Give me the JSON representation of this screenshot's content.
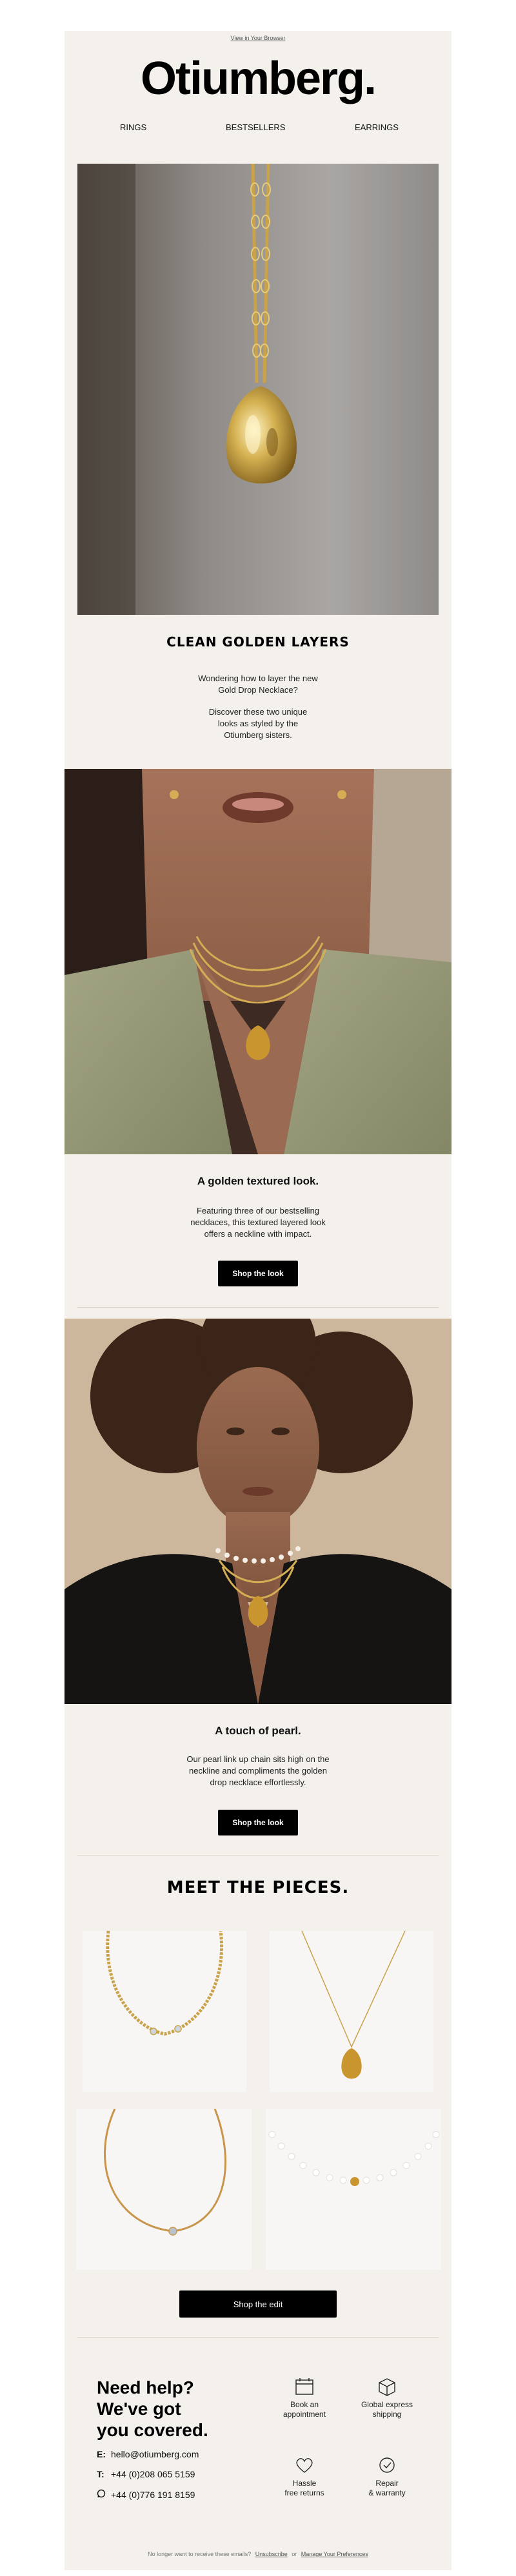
{
  "preheader": {
    "view_in_browser": "View in Your Browser"
  },
  "brand": {
    "logo": "Otiumberg."
  },
  "nav": {
    "items": [
      "RINGS",
      "BESTSELLERS",
      "EARRINGS"
    ]
  },
  "hero": {
    "title": "CLEAN GOLDEN LAYERS",
    "line1": "Wondering how to layer the new",
    "line2": "Gold Drop Necklace?",
    "line3": "Discover these two unique",
    "line4": "looks as styled by the",
    "line5": "Otiumberg sisters."
  },
  "look1": {
    "title": "A golden textured look.",
    "line1": "Featuring three of our bestselling",
    "line2": "necklaces, this textured layered look",
    "line3": "offers a neckline with impact.",
    "button": "Shop the look"
  },
  "look2": {
    "title": "A touch of pearl.",
    "line1": "Our pearl link up chain sits high on the",
    "line2": "neckline and compliments the golden",
    "line3": "drop necklace effortlessly.",
    "button": "Shop the look"
  },
  "pieces": {
    "title": "MEET THE PIECES.",
    "button": "Shop the edit"
  },
  "help": {
    "title_line1": "Need help?",
    "title_line2": "We've got",
    "title_line3": "you covered.",
    "email_label": "E:",
    "email": "hello@otiumberg.com",
    "phone_label": "T:",
    "phone": "+44 (0)208 065 5159",
    "whatsapp": "+44 (0)776 191 8159"
  },
  "services": [
    {
      "line1": "Book an",
      "line2": "appointment",
      "icon": "calendar-icon"
    },
    {
      "line1": "Global express",
      "line2": "shipping",
      "icon": "box-icon"
    },
    {
      "line1": "Hassle",
      "line2": "free returns",
      "icon": "heart-icon"
    },
    {
      "line1": "Repair",
      "line2": "& warranty",
      "icon": "check-badge-icon"
    }
  ],
  "footer": {
    "text": "No longer want to receive these emails?",
    "unsubscribe": "Unsubscribe",
    "or": "or",
    "preferences": "Manage Your Preferences"
  },
  "colors": {
    "background": "#f4f0ec",
    "button": "#000000",
    "gold": "#c9a24a"
  }
}
